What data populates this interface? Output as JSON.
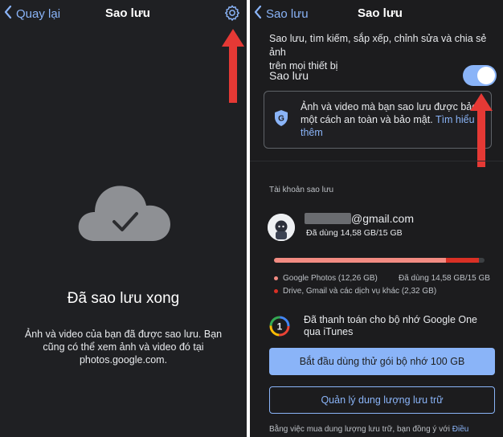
{
  "left": {
    "back_label": "Quay lại",
    "title": "Sao lưu",
    "done_title": "Đã sao lưu xong",
    "desc_line1": "Ảnh và video của bạn đã được sao lưu. Bạn",
    "desc_line2": "cũng có thể xem ảnh và video đó tại",
    "desc_line3": "photos.google.com."
  },
  "right": {
    "back_label": "Sao lưu",
    "title": "Sao lưu",
    "intro_line1": "Sao lưu, tìm kiếm, sắp xếp, chỉnh sửa và chia sẻ ảnh",
    "intro_line2": "trên mọi thiết bị",
    "backup_label": "Sao lưu",
    "backup_enabled": true,
    "info_line1": "Ảnh và video mà bạn sao lưu được bảo",
    "info_line2_prefix": "một cách an toàn và bảo mật.",
    "info_link_part1": "Tìm hiểu",
    "info_link_part2": "thêm",
    "account_section": "Tài khoản sao lưu",
    "email_suffix": "@gmail.com",
    "usage": "Đã dùng 14,58 GB/15 GB",
    "storage": {
      "used_fraction": 0.972,
      "photos_fraction": 0.817,
      "legend_photos": "Google Photos (12,26 GB)",
      "legend_used": "Đã dùng 14,58 GB/15 GB",
      "legend_other": "Drive, Gmail và các dịch vụ khác (2,32 GB)",
      "photos_color": "#f28b82",
      "other_color": "#d93025"
    },
    "paid_line1": "Đã thanh toán cho bộ nhớ Google One",
    "paid_line2": "qua iTunes",
    "trial_button": "Bắt đầu dùng thử gói bộ nhớ 100 GB",
    "manage_button": "Quản lý dung lượng lưu trữ",
    "footer_prefix": "Bằng việc mua dung lượng lưu trữ, bạn đồng ý với",
    "footer_link": "Điều"
  },
  "colors": {
    "accent": "#8ab4f8",
    "annotation_arrow": "#e53935"
  }
}
